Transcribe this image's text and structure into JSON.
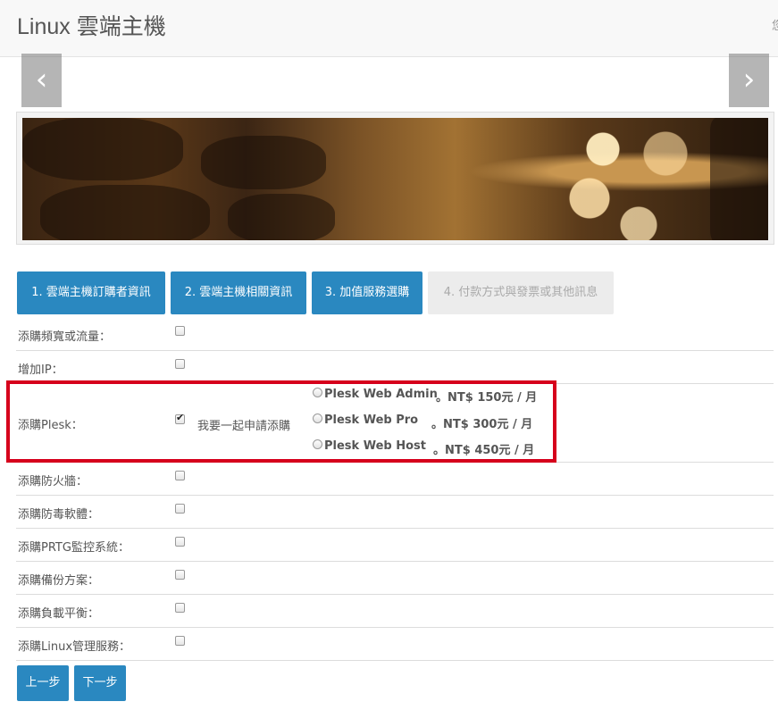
{
  "header": {
    "title": "Linux 雲端主機",
    "corner_text": "您"
  },
  "slider": {
    "prev_icon": "‹",
    "next_icon": "›"
  },
  "tabs": [
    {
      "label": "1. 雲端主機訂購者資訊",
      "state": "active"
    },
    {
      "label": "2. 雲端主機相關資訊",
      "state": "active"
    },
    {
      "label": "3. 加值服務選購",
      "state": "active"
    },
    {
      "label": "4. 付款方式與發票或其他訊息",
      "state": "disabled"
    }
  ],
  "addons": {
    "bandwidth": {
      "label": "添購頻寬或流量：",
      "checked": false
    },
    "ip": {
      "label": "增加IP：",
      "checked": false
    },
    "plesk": {
      "label": "添購Plesk：",
      "checked": true,
      "apply_label": "我要一起申請添購",
      "options": [
        {
          "name": "Plesk Web Admin",
          "price": "。NT$ 150元 / 月",
          "selected": false
        },
        {
          "name": "Plesk Web Pro",
          "price": "。NT$ 300元 / 月",
          "selected": false
        },
        {
          "name": "Plesk Web Host",
          "price": "。NT$ 450元 / 月",
          "selected": false
        }
      ]
    },
    "firewall": {
      "label": "添購防火牆：",
      "checked": false
    },
    "antivirus": {
      "label": "添購防毒軟體：",
      "checked": false
    },
    "prtg": {
      "label": "添購PRTG監控系統：",
      "checked": false
    },
    "backup": {
      "label": "添購備份方案：",
      "checked": false
    },
    "loadbalance": {
      "label": "添購負載平衡：",
      "checked": false
    },
    "linux_mgmt": {
      "label": "添購Linux管理服務：",
      "checked": false
    }
  },
  "buttons": {
    "prev": "上一步",
    "next": "下一步"
  },
  "colors": {
    "primary": "#2a88c0",
    "highlight_border": "#d6001c",
    "disabled_tab": "#ececec"
  }
}
